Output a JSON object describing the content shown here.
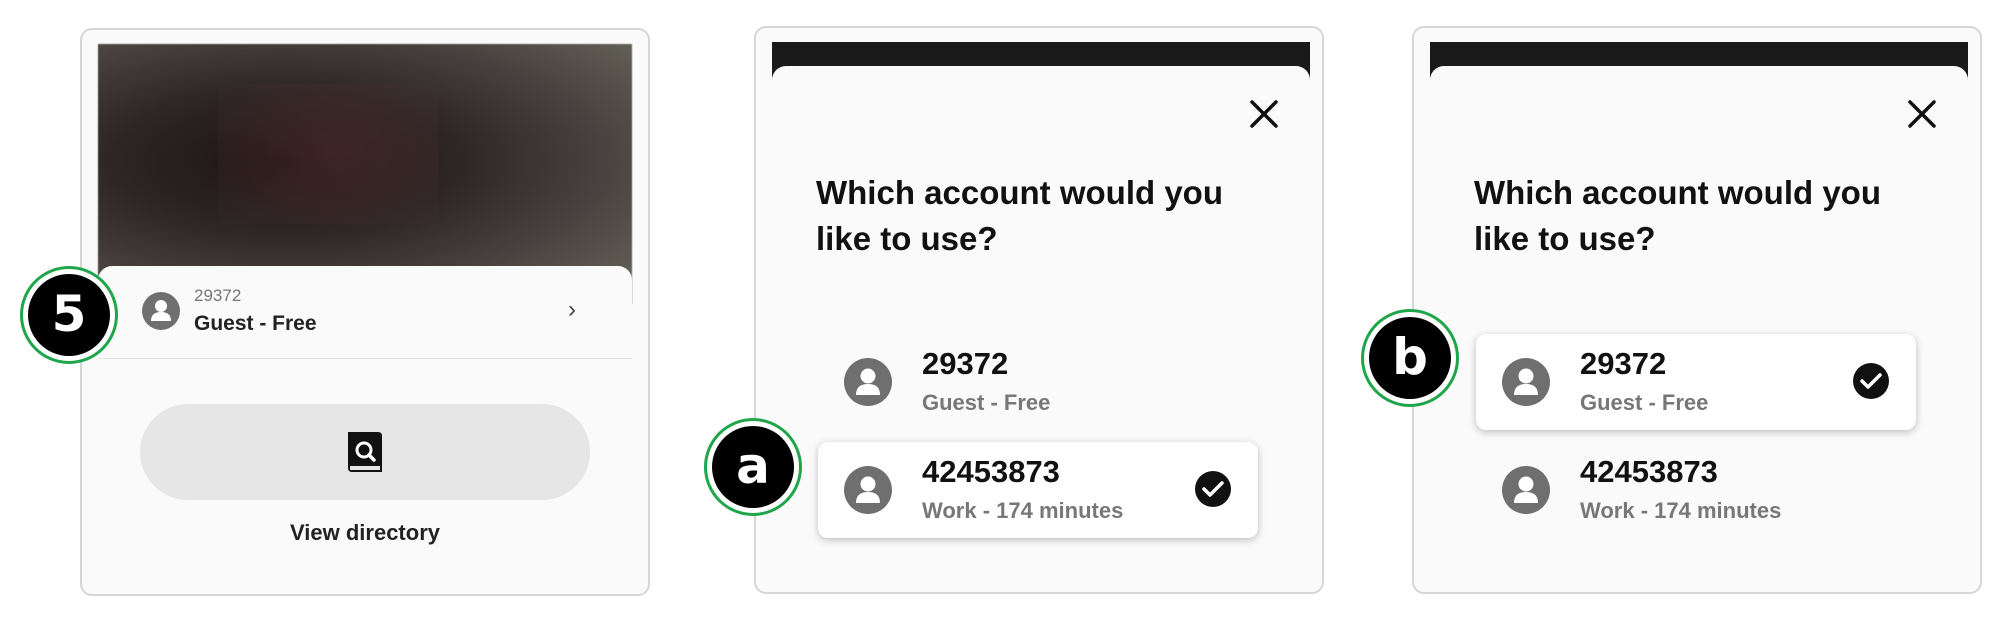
{
  "panel1": {
    "step": "5",
    "account_id": "29372",
    "account_plan": "Guest - Free",
    "view_directory_label": "View directory"
  },
  "panel2": {
    "step": "a",
    "question": "Which account would you like to use?",
    "options": [
      {
        "id": "29372",
        "plan": "Guest - Free",
        "selected": false
      },
      {
        "id": "42453873",
        "plan": "Work - 174 minutes",
        "selected": true
      }
    ]
  },
  "panel3": {
    "step": "b",
    "question": "Which account would you like to use?",
    "options": [
      {
        "id": "29372",
        "plan": "Guest - Free",
        "selected": true
      },
      {
        "id": "42453873",
        "plan": "Work - 174 minutes",
        "selected": false
      }
    ]
  },
  "icons": {
    "avatar": "user-icon",
    "chevron": "chevron-right-icon",
    "directory": "directory-search-icon",
    "close": "close-icon",
    "check": "check-circle-icon"
  },
  "colors": {
    "badge_ring": "#1fa64a",
    "badge_fill": "#000000"
  }
}
